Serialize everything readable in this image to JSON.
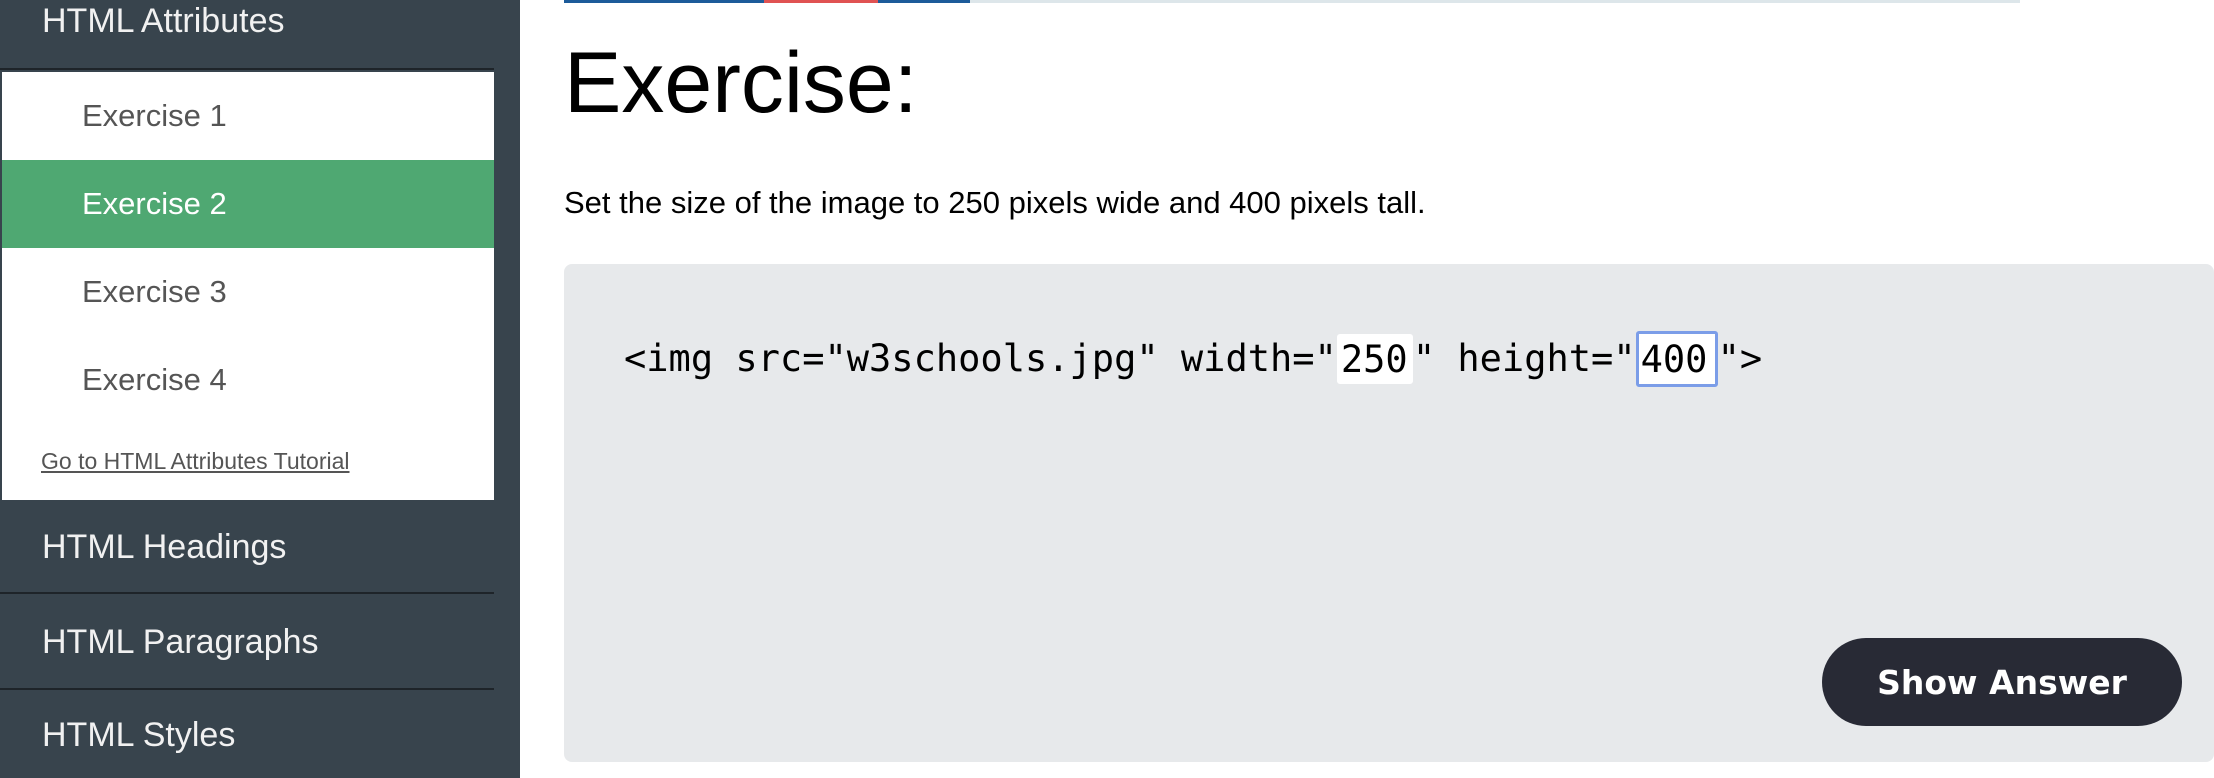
{
  "sidebar": {
    "current_category": "HTML Attributes",
    "exercises": [
      {
        "label": "Exercise 1",
        "active": false
      },
      {
        "label": "Exercise 2",
        "active": true
      },
      {
        "label": "Exercise 3",
        "active": false
      },
      {
        "label": "Exercise 4",
        "active": false
      }
    ],
    "tutorial_link": "Go to HTML Attributes Tutorial",
    "categories_below": [
      "HTML Headings",
      "HTML Paragraphs",
      "HTML Styles"
    ]
  },
  "progress_colors": [
    "#1c5b9a",
    "#e05252",
    "#1c5b9a",
    "#dde6ea"
  ],
  "main": {
    "heading": "Exercise:",
    "instructions": "Set the size of the image to 250 pixels wide and 400 pixels tall.",
    "code": {
      "prefix": "<img src=\"w3schools.jpg\" width=\"",
      "input1_value": "250",
      "middle": "\" height=\"",
      "input2_value": "400",
      "suffix": "\">"
    },
    "show_answer_label": "Show Answer"
  },
  "colors": {
    "sidebar_bg": "#38444d",
    "active_green": "#4fa872",
    "code_bg": "#e7e9eb",
    "button_bg": "#282a35",
    "focus_border": "#7b9de8"
  }
}
